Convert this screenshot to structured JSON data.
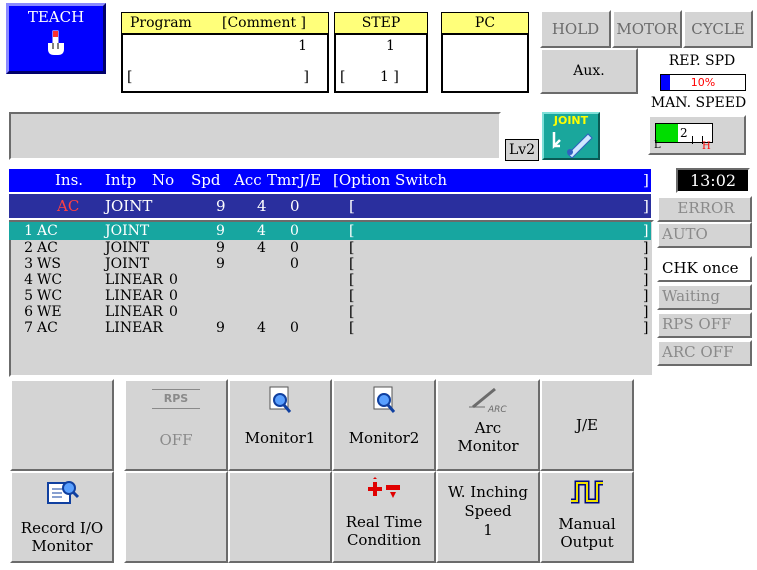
{
  "teach": {
    "label": "TEACH"
  },
  "program": {
    "header": "Program",
    "comment_header": "[Comment ]",
    "number": "1",
    "comment_open": "[",
    "comment_close": "]"
  },
  "step": {
    "header": "STEP",
    "value": "1",
    "sub_open": "[",
    "sub_value": "1 ]"
  },
  "pc": {
    "header": "PC"
  },
  "status_buttons": {
    "hold": "HOLD",
    "motor": "MOTOR",
    "cycle": "CYCLE"
  },
  "aux": {
    "label": "Aux."
  },
  "rep_spd": {
    "label": "REP. SPD",
    "value": "10%",
    "fill_fraction": 0.1
  },
  "man_speed": {
    "label": "MAN. SPEED",
    "value": "2",
    "high_marker": "H",
    "low_marker": "L"
  },
  "joint": {
    "label": "JOINT"
  },
  "level": {
    "label": "Lv2"
  },
  "clock": {
    "time": "13:02"
  },
  "table": {
    "header": {
      "ins": "Ins.",
      "intp": "Intp",
      "no": "No",
      "spd": "Spd",
      "acc": "Acc",
      "tmr": "Tmr",
      "je": "J/E",
      "opt": "[Option Switch",
      "close": "]"
    },
    "current": {
      "num": "",
      "ins": "AC",
      "intp": "JOINT",
      "no": "",
      "spd": "9",
      "acc": "4",
      "tmr": "0",
      "open": "[",
      "close": "]"
    },
    "rows": [
      {
        "num": "1",
        "ins": "AC",
        "intp": "JOINT",
        "no": "",
        "spd": "9",
        "acc": "4",
        "tmr": "0",
        "open": "[",
        "close": "]"
      },
      {
        "num": "2",
        "ins": "AC",
        "intp": "JOINT",
        "no": "",
        "spd": "9",
        "acc": "4",
        "tmr": "0",
        "open": "[",
        "close": "]"
      },
      {
        "num": "3",
        "ins": "WS",
        "intp": "JOINT",
        "no": "",
        "spd": "9",
        "acc": "",
        "tmr": "0",
        "open": "[",
        "close": "]"
      },
      {
        "num": "4",
        "ins": "WC",
        "intp": "LINEAR",
        "no": "0",
        "spd": "",
        "acc": "",
        "tmr": "",
        "open": "[",
        "close": "]"
      },
      {
        "num": "5",
        "ins": "WC",
        "intp": "LINEAR",
        "no": "0",
        "spd": "",
        "acc": "",
        "tmr": "",
        "open": "[",
        "close": "]"
      },
      {
        "num": "6",
        "ins": "WE",
        "intp": "LINEAR",
        "no": "0",
        "spd": "",
        "acc": "",
        "tmr": "",
        "open": "[",
        "close": "]"
      },
      {
        "num": "7",
        "ins": "AC",
        "intp": "LINEAR",
        "no": "",
        "spd": "9",
        "acc": "4",
        "tmr": "0",
        "open": "[",
        "close": "]"
      }
    ]
  },
  "side": {
    "error": "ERROR",
    "auto": "AUTO",
    "chk": "CHK once",
    "waiting": "Waiting",
    "rps": "RPS OFF",
    "arc": "ARC OFF"
  },
  "buttons_row1": {
    "rps_top": "RPS",
    "rps_bottom": "OFF",
    "monitor1": "Monitor1",
    "monitor2": "Monitor2",
    "arc_icon": "ARC",
    "arc_monitor_1": "Arc",
    "arc_monitor_2": "Monitor",
    "je": "J/E"
  },
  "buttons_row2": {
    "record_1": "Record I/O",
    "record_2": "Monitor",
    "rt_1": "Real Time",
    "rt_2": "Condition",
    "winch_1": "W. Inching",
    "winch_2": "Speed",
    "winch_3": "1",
    "mo_1": "Manual",
    "mo_2": "Output"
  },
  "colors": {
    "accent_blue": "#0000ff",
    "teach_blue": "#0000ff",
    "teal": "#17a6a0",
    "navy": "#2a2f9e",
    "yellow": "#ffff7a",
    "red": "#ff0000",
    "green": "#00dd00"
  }
}
